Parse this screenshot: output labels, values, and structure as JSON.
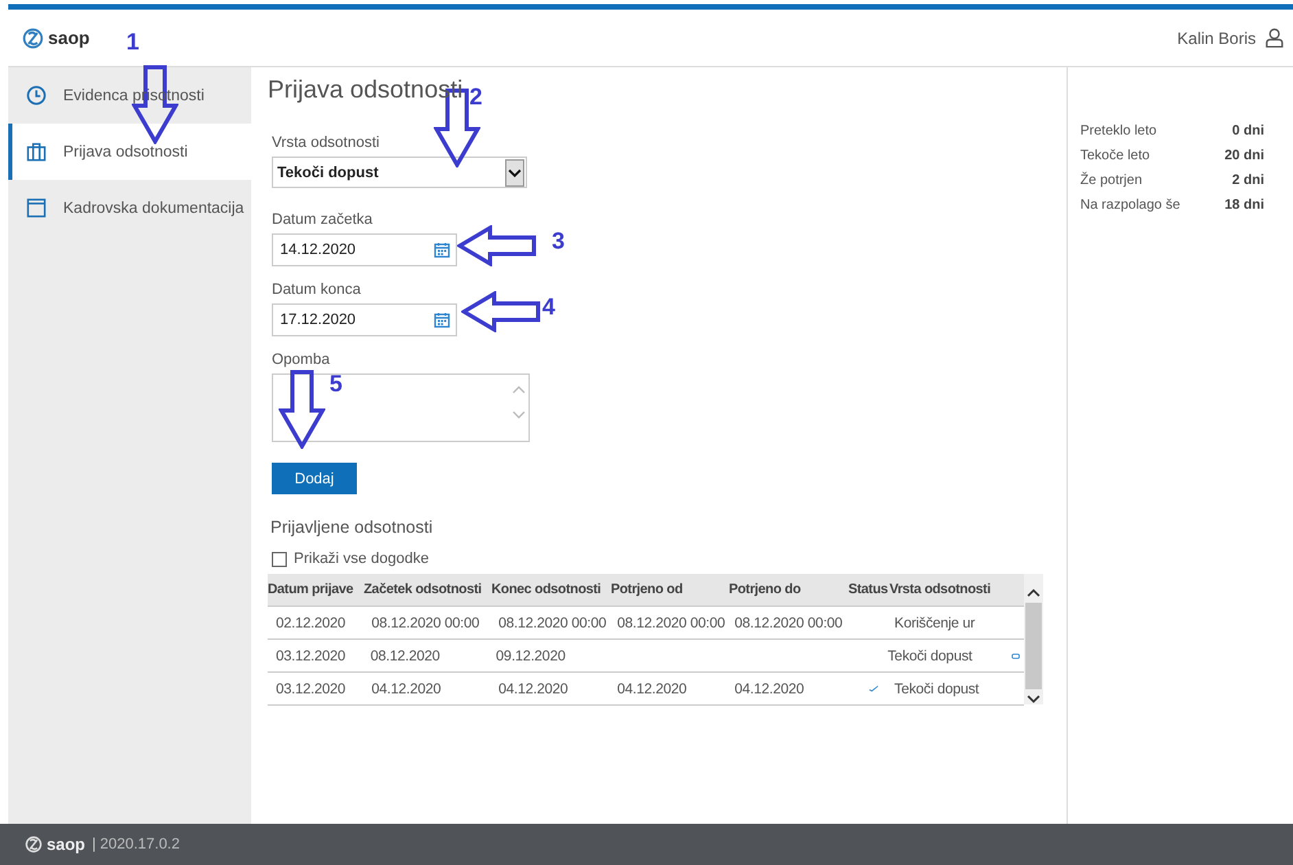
{
  "header": {
    "logo": "saop",
    "user": "Kalin Boris"
  },
  "sidebar": {
    "items": [
      {
        "label": "Evidenca prisotnosti",
        "selected": false
      },
      {
        "label": "Prijava odsotnosti",
        "selected": true
      },
      {
        "label": "Kadrovska dokumentacija",
        "selected": false
      }
    ]
  },
  "form": {
    "title": "Prijava odsotnosti",
    "type_label": "Vrsta odsotnosti",
    "type_value": "Tekoči dopust",
    "start_label": "Datum začetka",
    "start_value": "14.12.2020",
    "end_label": "Datum konca",
    "end_value": "17.12.2020",
    "note_label": "Opomba",
    "submit": "Dodaj"
  },
  "list": {
    "title": "Prijavljene odsotnosti",
    "show_all": {
      "label": "Prikaži vse dogodke",
      "checked": false
    },
    "columns": [
      "Datum prijave",
      "Začetek odsotnosti",
      "Konec odsotnosti",
      "Potrjeno od",
      "Potrjeno do",
      "Status",
      "Vrsta odsotnosti"
    ],
    "rows": [
      {
        "cells": [
          "02.12.2020",
          "08.12.2020 00:00",
          "08.12.2020 00:00",
          "08.12.2020 00:00",
          "08.12.2020 00:00",
          "Koriščenje ur"
        ],
        "approved": false,
        "has_note": false
      },
      {
        "cells": [
          "03.12.2020",
          "08.12.2020",
          "09.12.2020",
          "",
          "",
          "Tekoči dopust"
        ],
        "approved": false,
        "has_note": true
      },
      {
        "cells": [
          "03.12.2020",
          "04.12.2020",
          "04.12.2020",
          "04.12.2020",
          "04.12.2020",
          "Tekoči dopust"
        ],
        "approved": true,
        "has_note": false
      }
    ]
  },
  "summary": [
    {
      "label": "Preteklo leto",
      "value": "0 dni"
    },
    {
      "label": "Tekoče leto",
      "value": "20 dni"
    },
    {
      "label": "Že potrjen",
      "value": "2 dni"
    },
    {
      "label": "Na razpolago še",
      "value": "18 dni"
    }
  ],
  "footer": {
    "logo": "saop",
    "separator": "|",
    "version": "2020.17.0.2"
  },
  "annotations": [
    "1",
    "2",
    "3",
    "4",
    "5"
  ]
}
